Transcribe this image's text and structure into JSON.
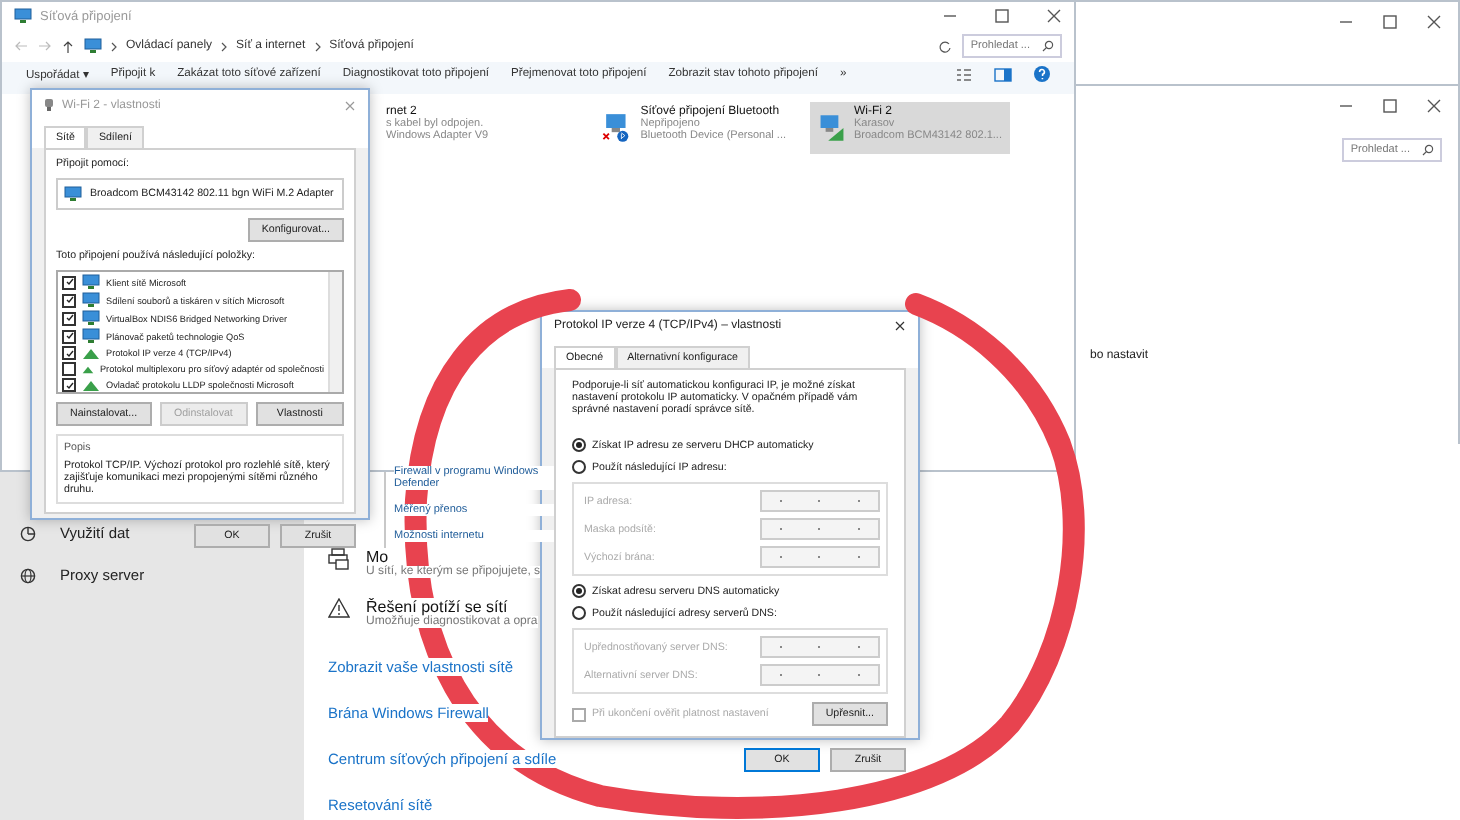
{
  "settings_window": {
    "sidebar_items": [
      {
        "label": "Využití dat",
        "kind": "data"
      },
      {
        "label": "Proxy server",
        "kind": "proxy"
      }
    ],
    "popup_items": [
      "Firewall v programu Windows Defender",
      "Měřený přenos",
      "Možnosti internetu"
    ],
    "sections": [
      {
        "kind": "sharing",
        "title": "Mo",
        "subtitle": "U sítí, ke kterým se připojujete, s"
      },
      {
        "kind": "troubleshoot",
        "title": "Řešení potíží se sítí",
        "subtitle": "Umožňuje diagnostikovat a opra"
      }
    ],
    "links": [
      "Zobrazit vaše vlastnosti sítě",
      "Brána Windows Firewall",
      "Centrum síťových připojení a sdíle",
      "Resetování sítě"
    ]
  },
  "back_window": {
    "search_placeholder": "Prohledat ...",
    "text": "bo nastavit"
  },
  "explorer": {
    "title": "Síťová připojení",
    "breadcrumb": [
      "Ovládací panely",
      "Síť a internet",
      "Síťová připojení"
    ],
    "search_placeholder": "Prohledat ...",
    "toolbar": [
      "Uspořádat ▾",
      "Připojit k",
      "Zakázat toto síťové zařízení",
      "Diagnostikovat toto připojení",
      "Přejmenovat toto připojení",
      "Zobrazit stav tohoto připojení",
      "»"
    ],
    "connections": [
      {
        "kind": "ethernet",
        "name": "rnet 2",
        "status": "s kabel byl odpojen.",
        "device": "Windows Adapter V9",
        "selected": false
      },
      {
        "kind": "bluetooth",
        "name": "Síťové připojení Bluetooth",
        "status": "Nepřipojeno",
        "device": "Bluetooth Device (Personal ...",
        "selected": false
      },
      {
        "kind": "wifi",
        "name": "Wi-Fi 2",
        "status": "Karasov",
        "device": "Broadcom BCM43142 802.1...",
        "selected": true
      }
    ]
  },
  "wifi_dialog": {
    "title": "Wi-Fi 2 - vlastnosti",
    "tabs": [
      {
        "label": "Sítě",
        "selected": true
      },
      {
        "label": "Sdílení",
        "selected": false
      }
    ],
    "connect_using_label": "Připojit pomocí:",
    "adapter": "Broadcom BCM43142 802.11 bgn WiFi M.2 Adapter",
    "configure_button": "Konfigurovat...",
    "items_label": "Toto připojení používá následující položky:",
    "items": [
      {
        "label": "Klient sítě Microsoft",
        "checked": true,
        "kind": "client"
      },
      {
        "label": "Sdílení souborů a tiskáren v sítích Microsoft",
        "checked": true,
        "kind": "client"
      },
      {
        "label": "VirtualBox NDIS6 Bridged Networking Driver",
        "checked": true,
        "kind": "client"
      },
      {
        "label": "Plánovač paketů technologie QoS",
        "checked": true,
        "kind": "client"
      },
      {
        "label": "Protokol IP verze 4 (TCP/IPv4)",
        "checked": true,
        "kind": "protocol"
      },
      {
        "label": "Protokol multiplexoru pro síťový adaptér od společnosti",
        "checked": false,
        "kind": "protocol"
      },
      {
        "label": "Ovladač protokolu LLDP společnosti Microsoft",
        "checked": true,
        "kind": "protocol"
      }
    ],
    "buttons": [
      {
        "label": "Nainstalovat...",
        "disabled": false
      },
      {
        "label": "Odinstalovat",
        "disabled": true
      },
      {
        "label": "Vlastnosti",
        "disabled": false
      }
    ],
    "description_label": "Popis",
    "description": "Protokol TCP/IP. Výchozí protokol pro rozlehlé sítě, který zajišťuje komunikaci mezi propojenými sítěmi různého druhu.",
    "footer_buttons": [
      "OK",
      "Zrušit"
    ]
  },
  "ipv4_dialog": {
    "title": "Protokol IP verze 4 (TCP/IPv4) – vlastnosti",
    "tabs": [
      {
        "label": "Obecné",
        "selected": true
      },
      {
        "label": "Alternativní konfigurace",
        "selected": false
      }
    ],
    "intro": "Podporuje-li síť automatickou konfiguraci IP, je možné získat nastavení protokolu IP automaticky. V opačném případě vám správné nastavení poradí správce sítě.",
    "ip_options": [
      {
        "label": "Získat IP adresu ze serveru DHCP automaticky",
        "selected": true
      },
      {
        "label": "Použít následující IP adresu:",
        "selected": false
      }
    ],
    "ip_fields": [
      "IP adresa:",
      "Maska podsítě:",
      "Výchozí brána:"
    ],
    "dns_options": [
      {
        "label": "Získat adresu serveru DNS automaticky",
        "selected": true
      },
      {
        "label": "Použít následující adresy serverů DNS:",
        "selected": false
      }
    ],
    "dns_fields": [
      "Upřednostňovaný server DNS:",
      "Alternativní server DNS:"
    ],
    "validate": {
      "label": "Při ukončení ověřit platnost nastavení",
      "checked": false
    },
    "advanced_button": "Upřesnit...",
    "footer_buttons": [
      "OK",
      "Zrušit"
    ]
  }
}
